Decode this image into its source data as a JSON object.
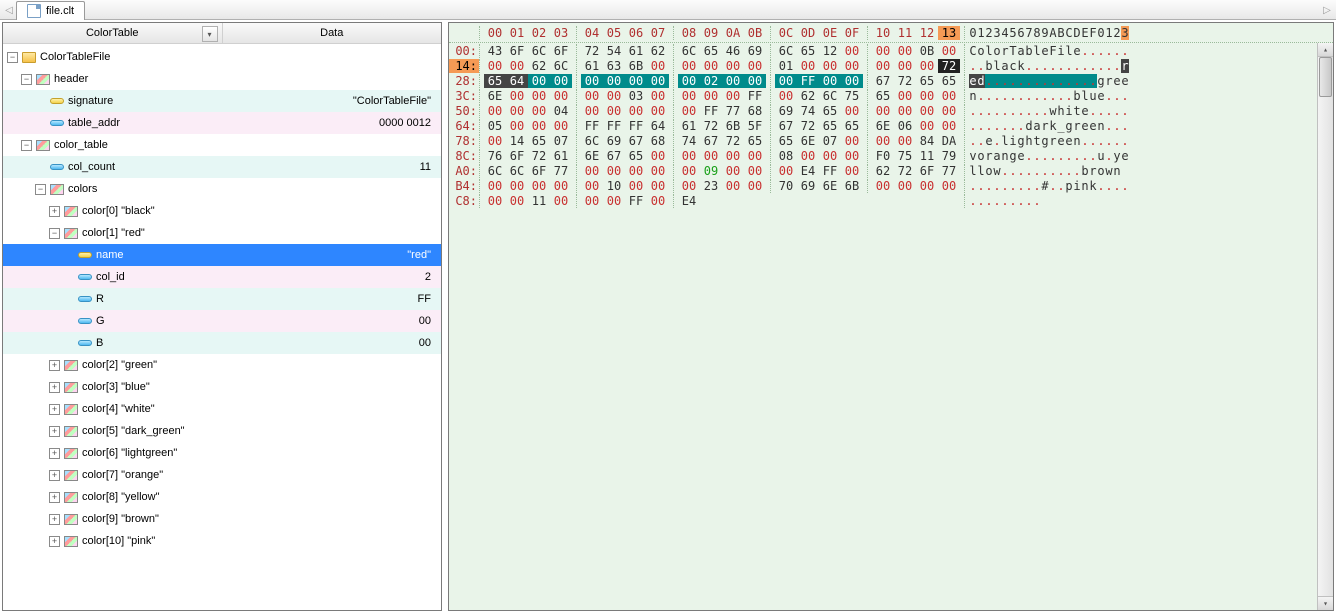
{
  "tab": {
    "filename": "file.clt"
  },
  "tree": {
    "cols": [
      "ColorTable",
      "Data"
    ],
    "root": {
      "label": "ColorTableFile",
      "expanded": true,
      "rowbg": "",
      "icon": "folder",
      "children": [
        {
          "label": "header",
          "icon": "struct",
          "expanded": true,
          "children": [
            {
              "label": "signature",
              "icon": "ystrip",
              "value": "\"ColorTableFile\"",
              "rowbg": "mint"
            },
            {
              "label": "table_addr",
              "icon": "field",
              "value": "0000 0012",
              "rowbg": "pink"
            }
          ]
        },
        {
          "label": "color_table",
          "icon": "struct",
          "expanded": true,
          "children": [
            {
              "label": "col_count",
              "icon": "field",
              "value": "11",
              "rowbg": "mint"
            },
            {
              "label": "colors",
              "icon": "struct",
              "expanded": true,
              "children": [
                {
                  "label": "color[0]  \"black\"",
                  "icon": "struct",
                  "expanded": false,
                  "exp": "+"
                },
                {
                  "label": "color[1]  \"red\"",
                  "icon": "struct",
                  "expanded": true,
                  "exp": "-",
                  "children": [
                    {
                      "label": "name",
                      "icon": "ystrip",
                      "value": "\"red\"",
                      "selected": true
                    },
                    {
                      "label": "col_id",
                      "icon": "field",
                      "value": "2",
                      "rowbg": "pink"
                    },
                    {
                      "label": "R",
                      "icon": "field",
                      "value": "FF",
                      "rowbg": "mint"
                    },
                    {
                      "label": "G",
                      "icon": "field",
                      "value": "00",
                      "rowbg": "pink"
                    },
                    {
                      "label": "B",
                      "icon": "field",
                      "value": "00",
                      "rowbg": "mint"
                    }
                  ]
                },
                {
                  "label": "color[2]  \"green\"",
                  "icon": "struct",
                  "exp": "+"
                },
                {
                  "label": "color[3]  \"blue\"",
                  "icon": "struct",
                  "exp": "+"
                },
                {
                  "label": "color[4]  \"white\"",
                  "icon": "struct",
                  "exp": "+"
                },
                {
                  "label": "color[5]  \"dark_green\"",
                  "icon": "struct",
                  "exp": "+"
                },
                {
                  "label": "color[6]  \"lightgreen\"",
                  "icon": "struct",
                  "exp": "+"
                },
                {
                  "label": "color[7]  \"orange\"",
                  "icon": "struct",
                  "exp": "+"
                },
                {
                  "label": "color[8]  \"yellow\"",
                  "icon": "struct",
                  "exp": "+"
                },
                {
                  "label": "color[9]  \"brown\"",
                  "icon": "struct",
                  "exp": "+"
                },
                {
                  "label": "color[10]  \"pink\"",
                  "icon": "struct",
                  "exp": "+"
                }
              ]
            }
          ]
        }
      ]
    }
  },
  "hex": {
    "header": [
      "00",
      "01",
      "02",
      "03",
      "04",
      "05",
      "06",
      "07",
      "08",
      "09",
      "0A",
      "0B",
      "0C",
      "0D",
      "0E",
      "0F",
      "10",
      "11",
      "12",
      "13"
    ],
    "highlight_col": "13",
    "ascii_header": "0123456789ABCDEF0123",
    "rows": [
      {
        "off": "00",
        "b": [
          "43",
          "6F",
          "6C",
          "6F",
          "72",
          "54",
          "61",
          "62",
          "6C",
          "65",
          "46",
          "69",
          "6C",
          "65",
          "12",
          "00",
          "00",
          "00",
          "0B",
          "00"
        ],
        "asc": "ColorTableFile......"
      },
      {
        "off": "14",
        "b": [
          "00",
          "00",
          "62",
          "6C",
          "61",
          "63",
          "6B",
          "00",
          "00",
          "00",
          "00",
          "00",
          "01",
          "00",
          "00",
          "00",
          "00",
          "00",
          "00",
          "72"
        ],
        "asc": "..black............r",
        "sel_off": true,
        "sel_bytes": [
          [
            19,
            19,
            "seld"
          ]
        ],
        "asc_sel": [
          [
            19,
            19,
            "sel"
          ]
        ]
      },
      {
        "off": "28",
        "b": [
          "65",
          "64",
          "00",
          "00",
          "00",
          "00",
          "00",
          "00",
          "00",
          "02",
          "00",
          "00",
          "00",
          "FF",
          "00",
          "00",
          "67",
          "72",
          "65",
          "65"
        ],
        "asc": "ed..............gree",
        "sel_bytes": [
          [
            0,
            1,
            "selb"
          ],
          [
            2,
            15,
            "selc"
          ]
        ],
        "asc_sel": [
          [
            0,
            1,
            "sel"
          ],
          [
            2,
            15,
            "selc"
          ]
        ]
      },
      {
        "off": "3C",
        "b": [
          "6E",
          "00",
          "00",
          "00",
          "00",
          "00",
          "03",
          "00",
          "00",
          "00",
          "00",
          "FF",
          "00",
          "62",
          "6C",
          "75",
          "65",
          "00",
          "00",
          "00"
        ],
        "asc": "n............blue..."
      },
      {
        "off": "50",
        "b": [
          "00",
          "00",
          "00",
          "04",
          "00",
          "00",
          "00",
          "00",
          "00",
          "FF",
          "77",
          "68",
          "69",
          "74",
          "65",
          "00",
          "00",
          "00",
          "00",
          "00"
        ],
        "asc": "..........white....."
      },
      {
        "off": "64",
        "b": [
          "05",
          "00",
          "00",
          "00",
          "FF",
          "FF",
          "FF",
          "64",
          "61",
          "72",
          "6B",
          "5F",
          "67",
          "72",
          "65",
          "65",
          "6E",
          "06",
          "00",
          "00"
        ],
        "asc": ".......dark_green..."
      },
      {
        "off": "78",
        "b": [
          "00",
          "14",
          "65",
          "07",
          "6C",
          "69",
          "67",
          "68",
          "74",
          "67",
          "72",
          "65",
          "65",
          "6E",
          "07",
          "00",
          "00",
          "00",
          "84",
          "DA"
        ],
        "asc": "..e.lightgreen......"
      },
      {
        "off": "8C",
        "b": [
          "76",
          "6F",
          "72",
          "61",
          "6E",
          "67",
          "65",
          "00",
          "00",
          "00",
          "00",
          "00",
          "08",
          "00",
          "00",
          "00",
          "F0",
          "75",
          "11",
          "79",
          "65"
        ],
        "cut": 20,
        "asc": "vorange.........u.ye"
      },
      {
        "off": "A0",
        "b": [
          "6C",
          "6C",
          "6F",
          "77",
          "00",
          "00",
          "00",
          "00",
          "00",
          "09",
          "00",
          "00",
          "00",
          "E4",
          "FF",
          "00",
          "62",
          "72",
          "6F",
          "77",
          "6E"
        ],
        "cut": 20,
        "asc": "llow..........brown",
        "green": [
          9
        ]
      },
      {
        "off": "B4",
        "b": [
          "00",
          "00",
          "00",
          "00",
          "00",
          "10",
          "00",
          "00",
          "00",
          "23",
          "00",
          "00",
          "70",
          "69",
          "6E",
          "6B",
          "00",
          "00",
          "00",
          "00"
        ],
        "asc": ".........#..pink...."
      },
      {
        "off": "C8",
        "b": [
          "00",
          "00",
          "11",
          "00",
          "00",
          "00",
          "FF",
          "00",
          "E4"
        ],
        "asc": "........."
      }
    ]
  }
}
